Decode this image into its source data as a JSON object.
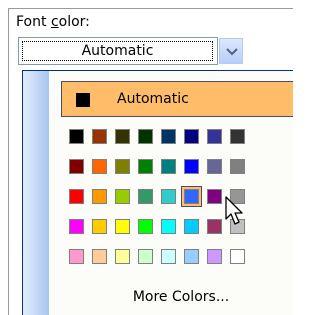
{
  "font_color": {
    "label_before": "Font ",
    "label_accel": "c",
    "label_after": "olor:",
    "combo_value": "Automatic"
  },
  "palette": {
    "automatic_label": "Automatic",
    "automatic_swatch": "#000000",
    "more_colors_label": "More Colors...",
    "selected": {
      "row": 2,
      "col": 5
    },
    "rows": [
      [
        "#000000",
        "#993300",
        "#333300",
        "#003300",
        "#003366",
        "#000080",
        "#333399",
        "#333333"
      ],
      [
        "#800000",
        "#ff6600",
        "#808000",
        "#008000",
        "#008080",
        "#0000ff",
        "#666699",
        "#808080"
      ],
      [
        "#ff0000",
        "#ff9900",
        "#99cc00",
        "#339966",
        "#33cccc",
        "#3366ff",
        "#800080",
        "#969696"
      ],
      [
        "#ff00ff",
        "#ffcc00",
        "#ffff00",
        "#00ff00",
        "#00ffff",
        "#00ccff",
        "#993366",
        "#c0c0c0"
      ],
      [
        "#ff99cc",
        "#ffcc99",
        "#ffff99",
        "#ccffcc",
        "#ccffff",
        "#99ccff",
        "#cc99ff",
        "#ffffff"
      ]
    ]
  }
}
